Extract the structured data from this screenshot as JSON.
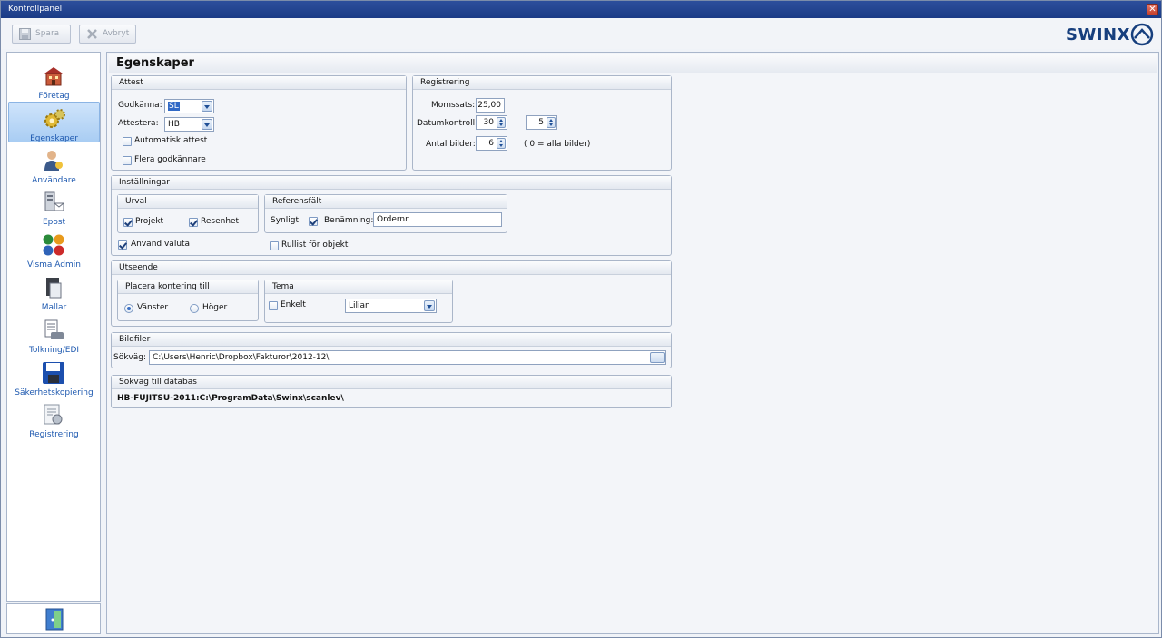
{
  "window": {
    "title": "Kontrollpanel",
    "close_glyph": "✕"
  },
  "toolbar": {
    "save_label": "Spara",
    "cancel_label": "Avbryt"
  },
  "logo": {
    "text": "SWINX"
  },
  "sidebar": {
    "items": [
      {
        "label": "Företag",
        "icon": "company-building-icon"
      },
      {
        "label": "Egenskaper",
        "icon": "gears-icon",
        "active": true
      },
      {
        "label": "Användare",
        "icon": "users-icon"
      },
      {
        "label": "Epost",
        "icon": "email-server-icon"
      },
      {
        "label": "Visma Admin",
        "icon": "visma-admin-icon"
      },
      {
        "label": "Mallar",
        "icon": "templates-icon"
      },
      {
        "label": "Tolkning/EDI",
        "icon": "edi-scanner-icon"
      },
      {
        "label": "Säkerhetskopiering",
        "icon": "floppy-disk-icon"
      },
      {
        "label": "Registrering",
        "icon": "registration-icon"
      }
    ],
    "exit_icon": "exit-door-icon"
  },
  "main": {
    "title": "Egenskaper",
    "attest": {
      "title": "Attest",
      "godkanna_label": "Godkänna:",
      "godkanna_value": "SL",
      "attestera_label": "Attestera:",
      "attestera_value": "HB",
      "auto_label": "Automatisk attest",
      "flera_label": "Flera godkännare"
    },
    "registrering": {
      "title": "Registrering",
      "momssats_label": "Momssats:",
      "momssats_value": "25,00",
      "datum_label": "Datumkontroll:",
      "datum_value1": "30",
      "datum_value2": "5",
      "antal_label": "Antal bilder:",
      "antal_value": "6",
      "antal_hint": "( 0 = alla bilder)"
    },
    "installningar": {
      "title": "Inställningar",
      "urval_title": "Urval",
      "projekt_label": "Projekt",
      "resenhet_label": "Resenhet",
      "valuta_label": "Använd valuta",
      "ref_title": "Referensfält",
      "synligt_label": "Synligt:",
      "benamning_label": "Benämning:",
      "benamning_value": "Ordernr",
      "rullist_label": "Rullist för objekt"
    },
    "utseende": {
      "title": "Utseende",
      "placera_title": "Placera kontering till",
      "vanster_label": "Vänster",
      "hoger_label": "Höger",
      "tema_title": "Tema",
      "enkelt_label": "Enkelt",
      "tema_value": "Lilian"
    },
    "bildfiler": {
      "title": "Bildfiler",
      "sokvag_label": "Sökväg:",
      "sokvag_value": "C:\\Users\\Henric\\Dropbox\\Fakturor\\2012-12\\",
      "browse_label": "...."
    },
    "databas": {
      "title": "Sökväg till databas",
      "value": "HB-FUJITSU-2011:C:\\ProgramData\\Swinx\\scanlev\\"
    }
  }
}
